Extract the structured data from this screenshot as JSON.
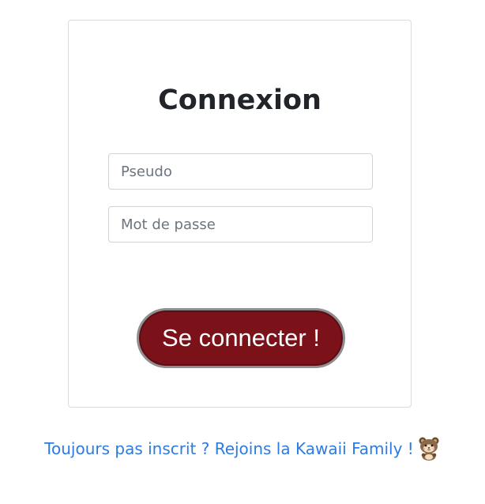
{
  "login": {
    "title": "Connexion",
    "pseudo_placeholder": "Pseudo",
    "password_placeholder": "Mot de passe",
    "submit_label": "Se connecter !"
  },
  "signup": {
    "link_text": "Toujours pas inscrit ? Rejoins la Kawaii Family !",
    "mascot_icon": "kawaii-bear-icon"
  },
  "colors": {
    "submit_background": "#7b1119",
    "link": "#2d7be0",
    "title": "#212529"
  }
}
